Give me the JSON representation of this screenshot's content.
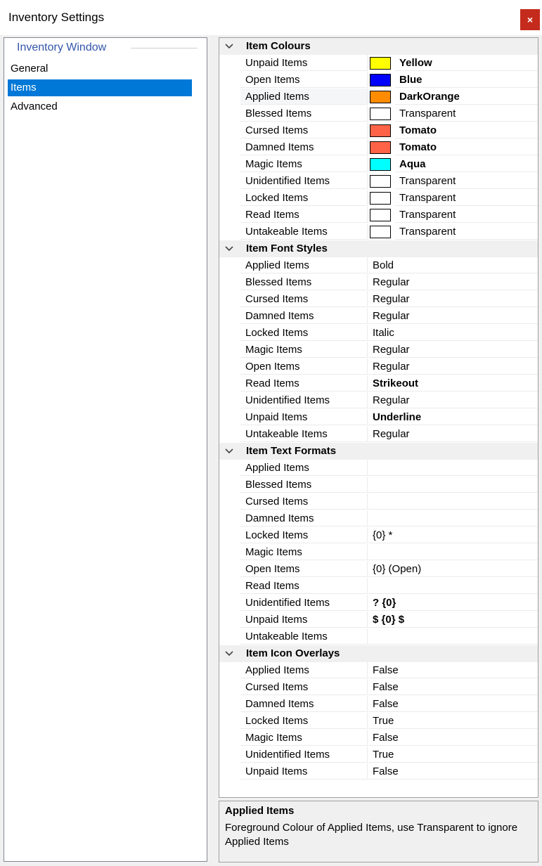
{
  "window": {
    "title": "Inventory Settings",
    "close_glyph": "×"
  },
  "nav": {
    "group_label": "Inventory Window",
    "items": [
      {
        "label": "General",
        "selected": false
      },
      {
        "label": "Items",
        "selected": true
      },
      {
        "label": "Advanced",
        "selected": false
      }
    ]
  },
  "property_grid": {
    "categories": [
      {
        "name": "Item Colours",
        "expand_icon": "chevron-down-icon",
        "properties": [
          {
            "name": "Unpaid Items",
            "value": "Yellow",
            "color": "#ffff00",
            "bold": true
          },
          {
            "name": "Open Items",
            "value": "Blue",
            "color": "#0000ff",
            "bold": true
          },
          {
            "name": "Applied Items",
            "value": "DarkOrange",
            "color": "#ff8c00",
            "bold": true,
            "selected": true
          },
          {
            "name": "Blessed Items",
            "value": "Transparent",
            "color": "#ffffff",
            "bold": false
          },
          {
            "name": "Cursed Items",
            "value": "Tomato",
            "color": "#ff6347",
            "bold": true
          },
          {
            "name": "Damned Items",
            "value": "Tomato",
            "color": "#ff6347",
            "bold": true
          },
          {
            "name": "Magic Items",
            "value": "Aqua",
            "color": "#00ffff",
            "bold": true
          },
          {
            "name": "Unidentified Items",
            "value": "Transparent",
            "color": "#ffffff",
            "bold": false
          },
          {
            "name": "Locked Items",
            "value": "Transparent",
            "color": "#ffffff",
            "bold": false
          },
          {
            "name": "Read Items",
            "value": "Transparent",
            "color": "#ffffff",
            "bold": false
          },
          {
            "name": "Untakeable Items",
            "value": "Transparent",
            "color": "#ffffff",
            "bold": false
          }
        ]
      },
      {
        "name": "Item Font Styles",
        "expand_icon": "chevron-down-icon",
        "properties": [
          {
            "name": "Applied Items",
            "value": "Bold",
            "bold": false
          },
          {
            "name": "Blessed Items",
            "value": "Regular",
            "bold": false
          },
          {
            "name": "Cursed Items",
            "value": "Regular",
            "bold": false
          },
          {
            "name": "Damned Items",
            "value": "Regular",
            "bold": false
          },
          {
            "name": "Locked Items",
            "value": "Italic",
            "bold": false
          },
          {
            "name": "Magic Items",
            "value": "Regular",
            "bold": false
          },
          {
            "name": "Open Items",
            "value": "Regular",
            "bold": false
          },
          {
            "name": "Read Items",
            "value": "Strikeout",
            "bold": true
          },
          {
            "name": "Unidentified Items",
            "value": "Regular",
            "bold": false
          },
          {
            "name": "Unpaid Items",
            "value": "Underline",
            "bold": true
          },
          {
            "name": "Untakeable Items",
            "value": "Regular",
            "bold": false
          }
        ]
      },
      {
        "name": "Item Text Formats",
        "expand_icon": "chevron-down-icon",
        "properties": [
          {
            "name": "Applied Items",
            "value": "",
            "bold": false
          },
          {
            "name": "Blessed Items",
            "value": "",
            "bold": false
          },
          {
            "name": "Cursed Items",
            "value": "",
            "bold": false
          },
          {
            "name": "Damned Items",
            "value": "",
            "bold": false
          },
          {
            "name": "Locked Items",
            "value": "{0} *",
            "bold": false
          },
          {
            "name": "Magic Items",
            "value": "",
            "bold": false
          },
          {
            "name": "Open Items",
            "value": "{0} (Open)",
            "bold": false
          },
          {
            "name": "Read Items",
            "value": "",
            "bold": false
          },
          {
            "name": "Unidentified Items",
            "value": "? {0}",
            "bold": true
          },
          {
            "name": "Unpaid Items",
            "value": "$ {0} $",
            "bold": true
          },
          {
            "name": "Untakeable Items",
            "value": "",
            "bold": false
          }
        ]
      },
      {
        "name": "Item Icon Overlays",
        "expand_icon": "chevron-down-icon",
        "properties": [
          {
            "name": "Applied Items",
            "value": "False",
            "bold": false
          },
          {
            "name": "Cursed Items",
            "value": "False",
            "bold": false
          },
          {
            "name": "Damned Items",
            "value": "False",
            "bold": false
          },
          {
            "name": "Locked Items",
            "value": "True",
            "bold": false
          },
          {
            "name": "Magic Items",
            "value": "False",
            "bold": false
          },
          {
            "name": "Unidentified Items",
            "value": "True",
            "bold": false
          },
          {
            "name": "Unpaid Items",
            "value": "False",
            "bold": false
          }
        ]
      }
    ]
  },
  "description": {
    "title": "Applied Items",
    "text": "Foreground Colour of Applied Items, use Transparent to ignore Applied Items"
  }
}
